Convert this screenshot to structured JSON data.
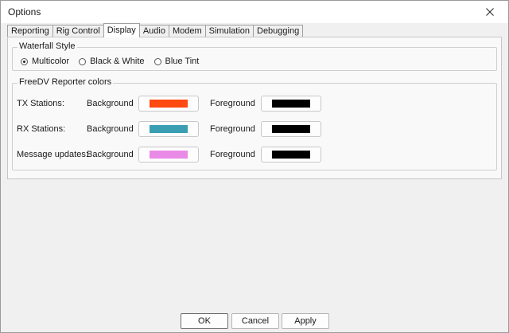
{
  "window": {
    "title": "Options"
  },
  "tabs": [
    "Reporting",
    "Rig Control",
    "Display",
    "Audio",
    "Modem",
    "Simulation",
    "Debugging"
  ],
  "active_tab": "Display",
  "waterfall": {
    "legend": "Waterfall Style",
    "options": [
      "Multicolor",
      "Black & White",
      "Blue Tint"
    ],
    "selected": "Multicolor"
  },
  "reporter": {
    "legend": "FreeDV Reporter colors",
    "background_label": "Background",
    "foreground_label": "Foreground",
    "rows": [
      {
        "label": "TX Stations:",
        "bg_color": "#ff4a10",
        "fg_color": "#000000"
      },
      {
        "label": "RX Stations:",
        "bg_color": "#3a9fb3",
        "fg_color": "#000000"
      },
      {
        "label": "Message updates:",
        "bg_color": "#e98ae6",
        "fg_color": "#000000"
      }
    ]
  },
  "buttons": {
    "ok": "OK",
    "cancel": "Cancel",
    "apply": "Apply"
  }
}
